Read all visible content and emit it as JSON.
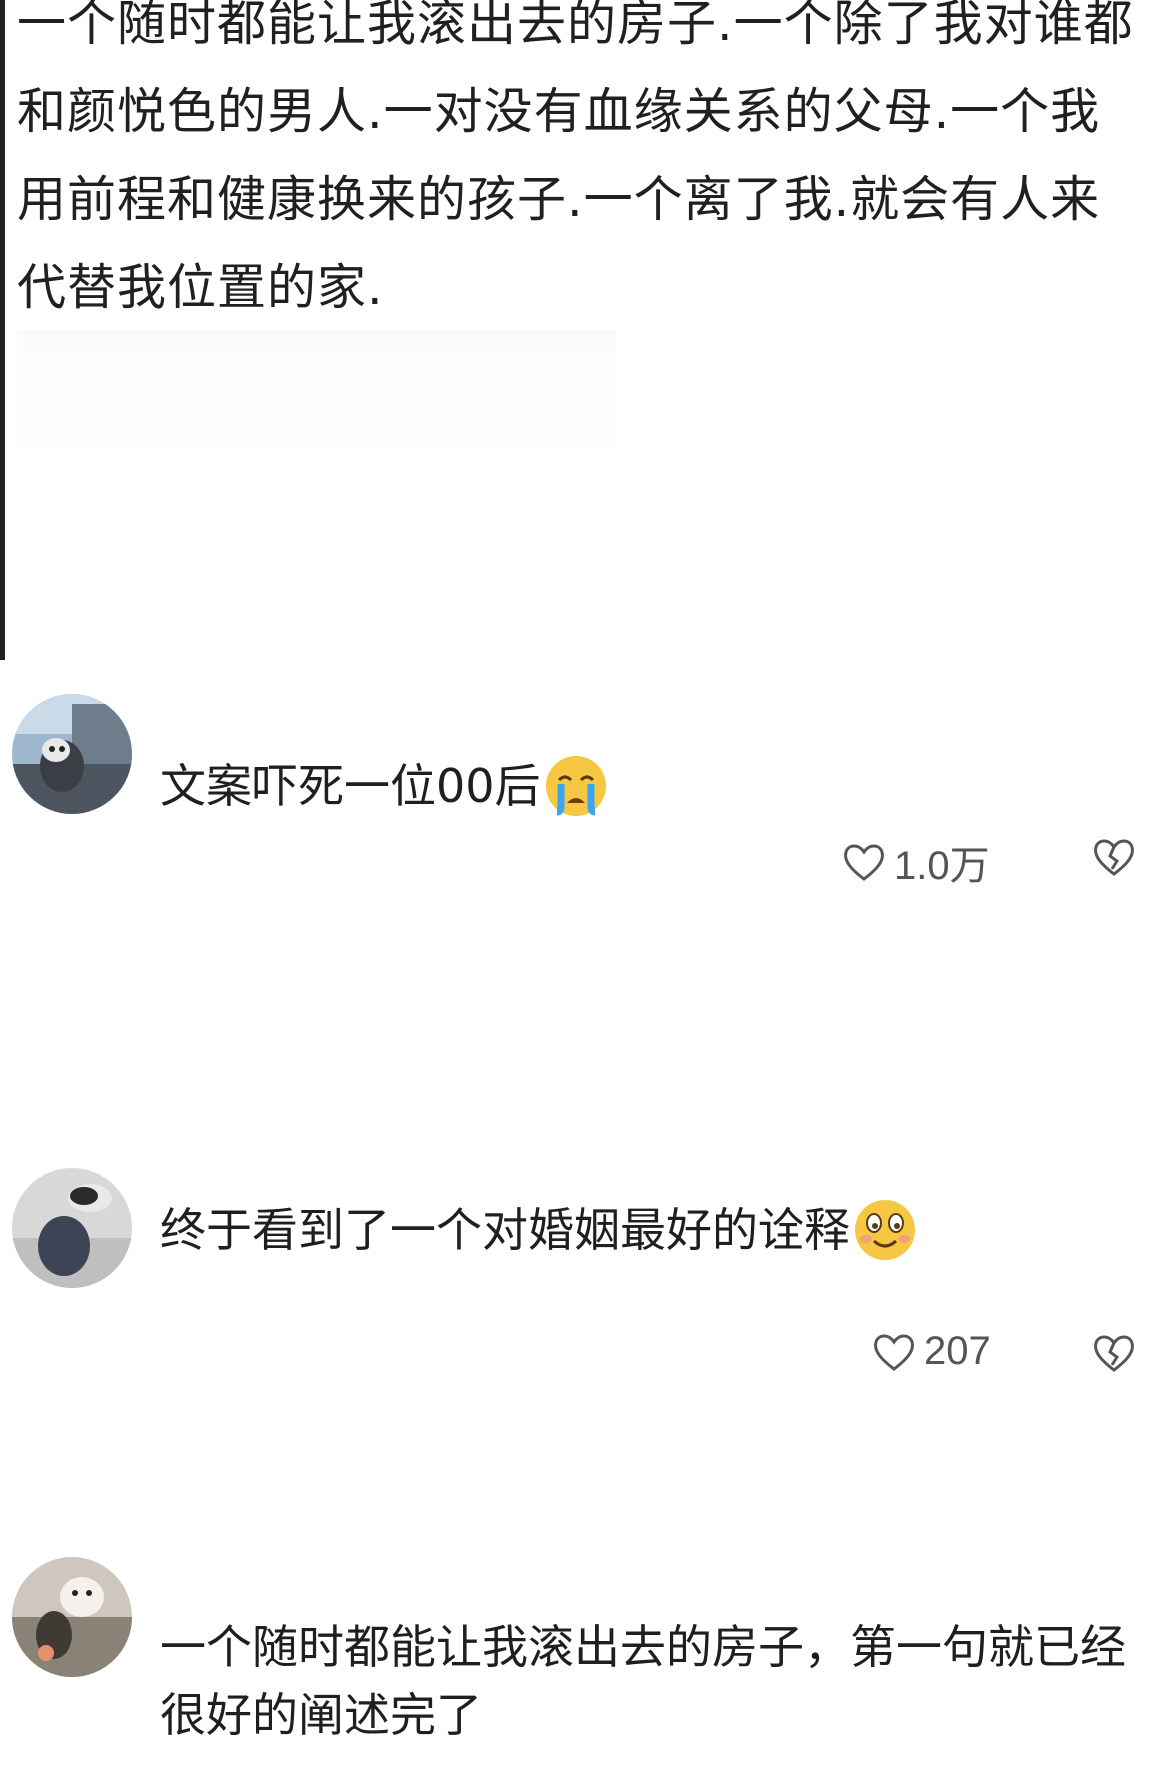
{
  "post": {
    "text": "一个随时都能让我滚出去的房子.一个除了我对谁都和颜悦色的男人.一对没有血缘关系的父母.一个我用前程和健康换来的孩子.一个离了我.就会有人来代替我位置的家."
  },
  "comments": [
    {
      "avatar": "avatar-cat-in-car",
      "text": "文案吓死一位00后",
      "emoji": "crying-face-emoji",
      "likes": "1.0万",
      "like_icon": "heart-outline-icon",
      "dislike_icon": "broken-heart-icon"
    },
    {
      "avatar": "avatar-person-lying",
      "text": "终于看到了一个对婚姻最好的诠释",
      "emoji": "smiling-face-emoji",
      "likes": "207",
      "like_icon": "heart-outline-icon",
      "dislike_icon": "broken-heart-icon"
    },
    {
      "avatar": "avatar-white-cat",
      "text": "一个随时都能让我滚出去的房子，第一句就已经很好的阐述完了"
    }
  ],
  "colors": {
    "text": "#1f1f1f",
    "meta": "#555555",
    "emoji": "#f6c743"
  }
}
